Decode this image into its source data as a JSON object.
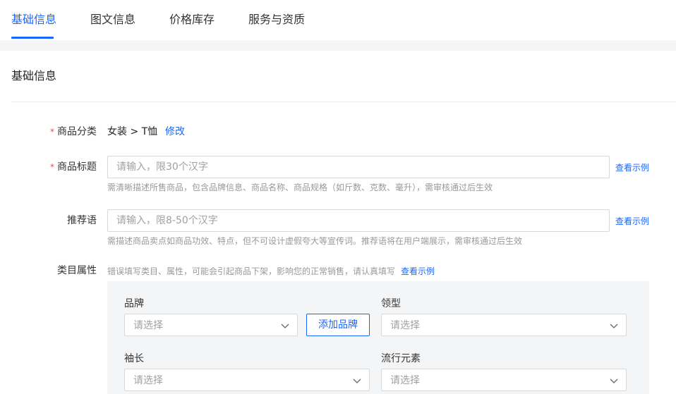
{
  "tabs": [
    {
      "label": "基础信息",
      "active": true
    },
    {
      "label": "图文信息",
      "active": false
    },
    {
      "label": "价格库存",
      "active": false
    },
    {
      "label": "服务与资质",
      "active": false
    }
  ],
  "section": {
    "title": "基础信息"
  },
  "form": {
    "required_mark": "*",
    "category": {
      "label": "商品分类",
      "value": "女装 > T恤",
      "edit_label": "修改"
    },
    "title": {
      "label": "商品标题",
      "placeholder": "请输入，限30个汉字",
      "value": "",
      "example_link": "查看示例",
      "hint": "需清晰描述所售商品，包含品牌信息、商品名称、商品规格（如斤数、克数、毫升），需审核通过后生效"
    },
    "recommend": {
      "label": "推荐语",
      "placeholder": "请输入，限8-50个汉字",
      "value": "",
      "example_link": "查看示例",
      "hint": "需描述商品卖点如商品功效、特点，但不可设计虚假夸大等宣传词。推荐语将在用户端展示，需审核通过后生效"
    },
    "attributes": {
      "label": "类目属性",
      "hint": "错误填写类目、属性，可能会引起商品下架，影响您的正常销售，请认真填写",
      "example_link": "查看示例",
      "brand": {
        "label": "品牌",
        "placeholder": "请选择",
        "add_button": "添加品牌"
      },
      "collar": {
        "label": "领型",
        "placeholder": "请选择"
      },
      "sleeve": {
        "label": "袖长",
        "placeholder": "请选择"
      },
      "trend": {
        "label": "流行元素",
        "placeholder": "请选择"
      }
    }
  },
  "colors": {
    "accent": "#1966ff",
    "required": "#f24b4b",
    "panel_bg": "#f4f5f7"
  },
  "icons": {
    "select_arrow": "chevron-down-icon"
  }
}
